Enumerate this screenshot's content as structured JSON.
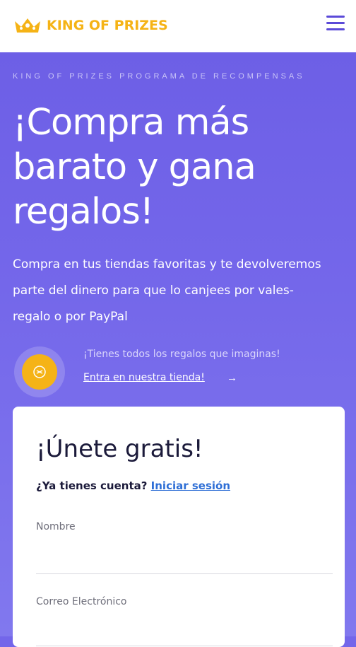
{
  "header": {
    "logo_text": "KING OF PRIZES",
    "logo_icon": "crown-icon",
    "menu_icon": "hamburger-menu-icon"
  },
  "hero": {
    "kicker": "KING OF PRIZES PROGRAMA DE RECOMPENSAS",
    "headline": "¡Compra más barato y gana regalos!",
    "description": "Compra en tus tiendas favoritas y te devolveremos parte del dinero para que lo canjees por vales-regalo o por PayPal"
  },
  "promo": {
    "icon": "gift-coin-icon",
    "text": "¡Tienes todos los regalos que imaginas!",
    "link_label": "Entra en nuestra tienda!",
    "arrow": "→"
  },
  "signup": {
    "title": "¡Únete gratis!",
    "account_question": "¿Ya tienes cuenta?",
    "login_label": "Iniciar sesión",
    "fields": [
      {
        "label": "Nombre",
        "value": ""
      },
      {
        "label": "Correo Electrónico",
        "value": ""
      }
    ]
  },
  "colors": {
    "brand_purple": "#7366ea",
    "accent_gold": "#f5b316",
    "link_blue": "#2f6fd6"
  }
}
